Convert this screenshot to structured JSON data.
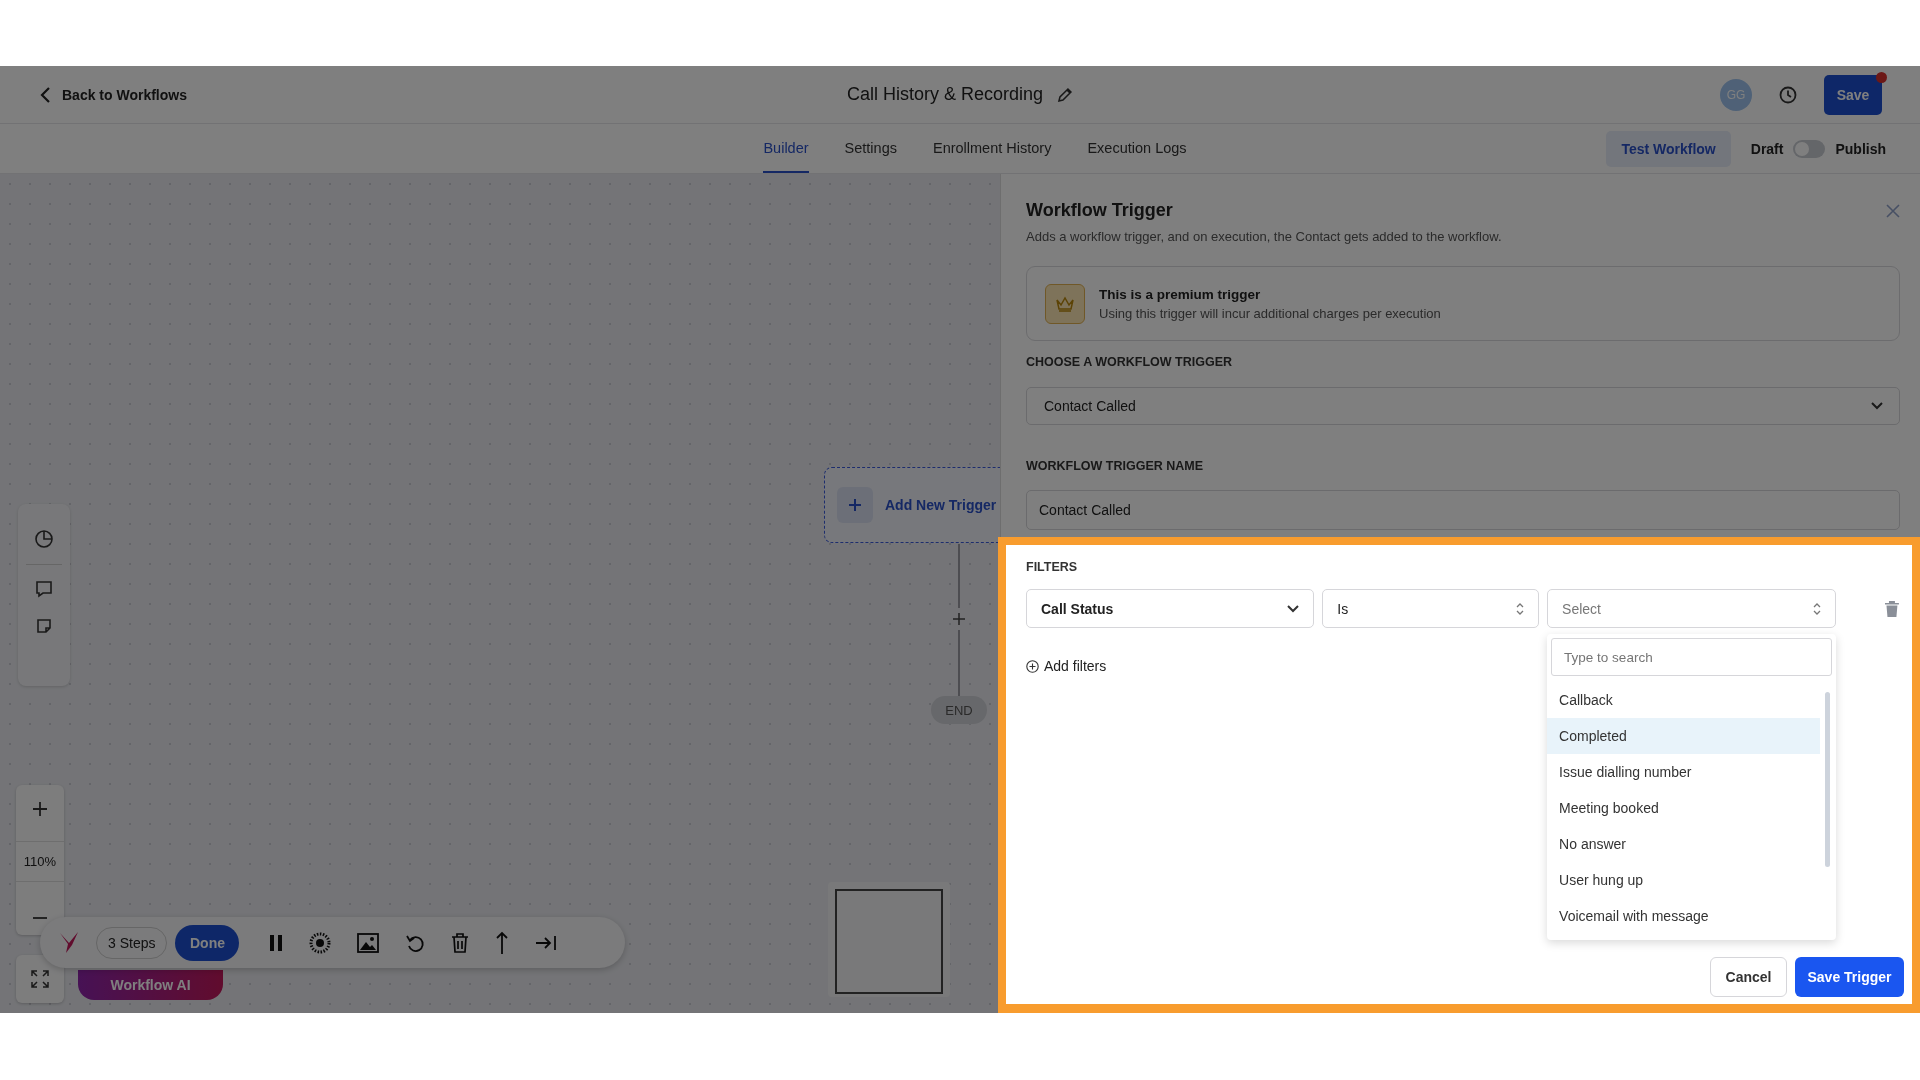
{
  "header": {
    "back_link": "Back to Workflows",
    "title": "Call History & Recording",
    "avatar": "GG",
    "save_button": "Save",
    "unsaved": true
  },
  "tabs": [
    {
      "label": "Builder",
      "selected": true
    },
    {
      "label": "Settings",
      "selected": false
    },
    {
      "label": "Enrollment History",
      "selected": false
    },
    {
      "label": "Execution Logs",
      "selected": false
    }
  ],
  "test_button": "Test Workflow",
  "publish": {
    "draft_label": "Draft",
    "publish_label": "Publish",
    "on": false
  },
  "canvas": {
    "trigger_node": "Add New Trigger",
    "end_node": "END",
    "zoom": "110%",
    "steps": "3 Steps",
    "done_button": "Done",
    "ai_button": "Workflow AI"
  },
  "panel": {
    "title": "Workflow Trigger",
    "description": "Adds a workflow trigger, and on execution, the Contact gets added to the workflow.",
    "premium": {
      "title": "This is a premium trigger",
      "text": "Using this trigger will incur additional charges per execution"
    },
    "trigger_label": "CHOOSE A WORKFLOW TRIGGER",
    "trigger_value": "Contact Called",
    "name_label": "WORKFLOW TRIGGER NAME",
    "name_value": "Contact Called",
    "filters_label": "FILTERS",
    "filter": {
      "field": "Call Status",
      "operator": "Is",
      "value_placeholder": "Select"
    },
    "add_filters": "Add filters",
    "dropdown": {
      "search_placeholder": "Type to search",
      "options": [
        {
          "label": "Callback",
          "selected": false
        },
        {
          "label": "Completed",
          "selected": true
        },
        {
          "label": "Issue dialling number",
          "selected": false
        },
        {
          "label": "Meeting booked",
          "selected": false
        },
        {
          "label": "No answer",
          "selected": false
        },
        {
          "label": "User hung up",
          "selected": false
        },
        {
          "label": "Voicemail with message",
          "selected": false
        }
      ]
    },
    "cancel_button": "Cancel",
    "save_button": "Save Trigger"
  }
}
